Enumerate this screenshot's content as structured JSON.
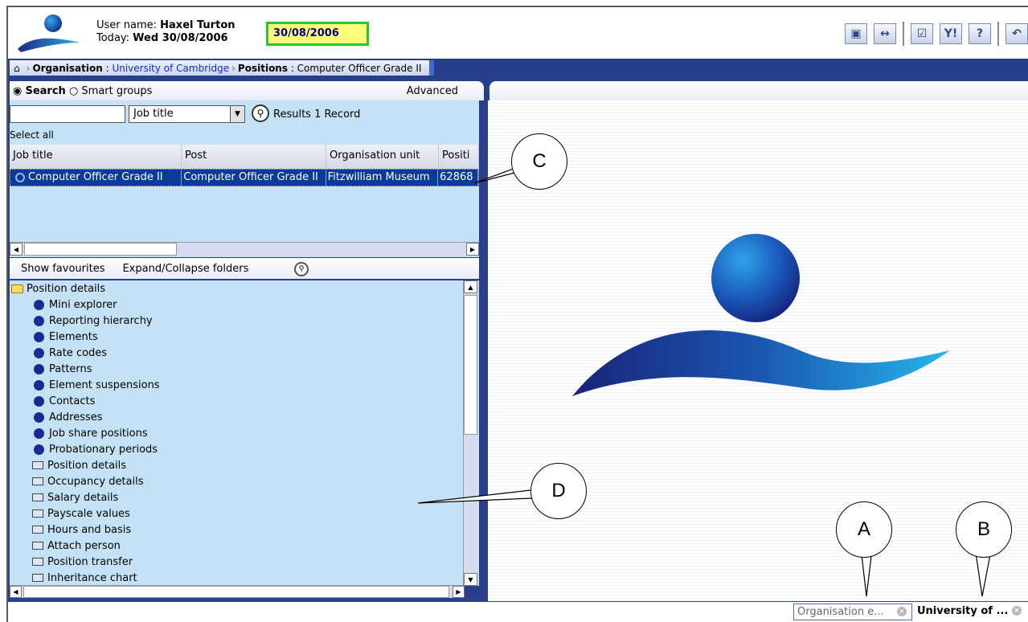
{
  "header": {
    "user_name_label": "User name:",
    "user_name": "Haxel Turton",
    "today_label": "Today:",
    "today": "Wed 30/08/2006",
    "date_field": "30/08/2006"
  },
  "toolbar": {
    "icons": [
      "window-icon",
      "resize-icon",
      "checklist-icon",
      "tools-icon",
      "help-icon",
      "exit-icon"
    ]
  },
  "breadcrumb": {
    "org_label": "Organisation",
    "org_value": "University of Cambridge",
    "positions_label": "Positions",
    "positions_value": "Computer Officer Grade II"
  },
  "search_tabs": {
    "search": "Search",
    "smart_groups": "Smart groups",
    "advanced": "Advanced"
  },
  "search": {
    "input_value": "",
    "field_select": "Job title",
    "results": "Results 1 Record",
    "select_all": "Select all"
  },
  "grid": {
    "columns": [
      "Job title",
      "Post",
      "Organisation unit",
      "Positi"
    ],
    "rows": [
      [
        "Computer Officer Grade II",
        "Computer Officer Grade II",
        "Fitzwilliam Museum",
        "62868"
      ]
    ]
  },
  "favourites": {
    "show": "Show favourites",
    "expand": "Expand/Collapse folders"
  },
  "tree": {
    "folder": "Position details",
    "items": [
      {
        "label": "Mini explorer",
        "type": "dot"
      },
      {
        "label": "Reporting hierarchy",
        "type": "dot"
      },
      {
        "label": "Elements",
        "type": "dot"
      },
      {
        "label": "Rate codes",
        "type": "dot"
      },
      {
        "label": "Patterns",
        "type": "dot"
      },
      {
        "label": "Element suspensions",
        "type": "dot"
      },
      {
        "label": "Contacts",
        "type": "dot"
      },
      {
        "label": "Addresses",
        "type": "dot"
      },
      {
        "label": "Job share positions",
        "type": "dot"
      },
      {
        "label": "Probationary periods",
        "type": "dot"
      },
      {
        "label": "Position details",
        "type": "form"
      },
      {
        "label": "Occupancy details",
        "type": "form"
      },
      {
        "label": "Salary details",
        "type": "form"
      },
      {
        "label": "Payscale values",
        "type": "form"
      },
      {
        "label": "Hours and basis",
        "type": "form"
      },
      {
        "label": "Attach person",
        "type": "form"
      },
      {
        "label": "Position transfer",
        "type": "form"
      },
      {
        "label": "Inheritance chart",
        "type": "form"
      }
    ]
  },
  "bottom_tabs": {
    "tab1": "Organisation e...",
    "tab2": "University of ..."
  },
  "callouts": {
    "a": "A",
    "b": "B",
    "c": "C",
    "d": "D"
  },
  "colors": {
    "brand_blue": "#2a3f8c",
    "panel_blue": "#c5e1f5",
    "selected_row": "#0a3b9c",
    "date_highlight": "#ffff7a",
    "date_border": "#2ec42e"
  }
}
